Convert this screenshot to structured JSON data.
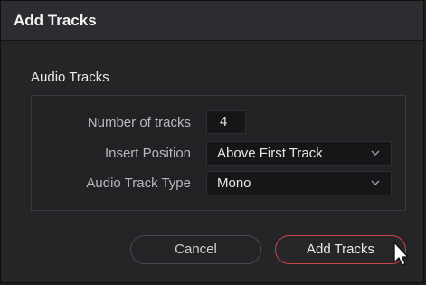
{
  "dialog": {
    "title": "Add Tracks"
  },
  "audio_tracks": {
    "section_title": "Audio Tracks",
    "number_of_tracks_label": "Number of tracks",
    "number_of_tracks_value": "4",
    "insert_position_label": "Insert Position",
    "insert_position_value": "Above First Track",
    "track_type_label": "Audio Track Type",
    "track_type_value": "Mono"
  },
  "buttons": {
    "cancel_label": "Cancel",
    "add_label": "Add Tracks"
  },
  "icons": {
    "dropdown": "chevron-down-icon",
    "cursor": "mouse-pointer-icon"
  },
  "colors": {
    "accent": "#c8454a",
    "background": "#252528"
  }
}
